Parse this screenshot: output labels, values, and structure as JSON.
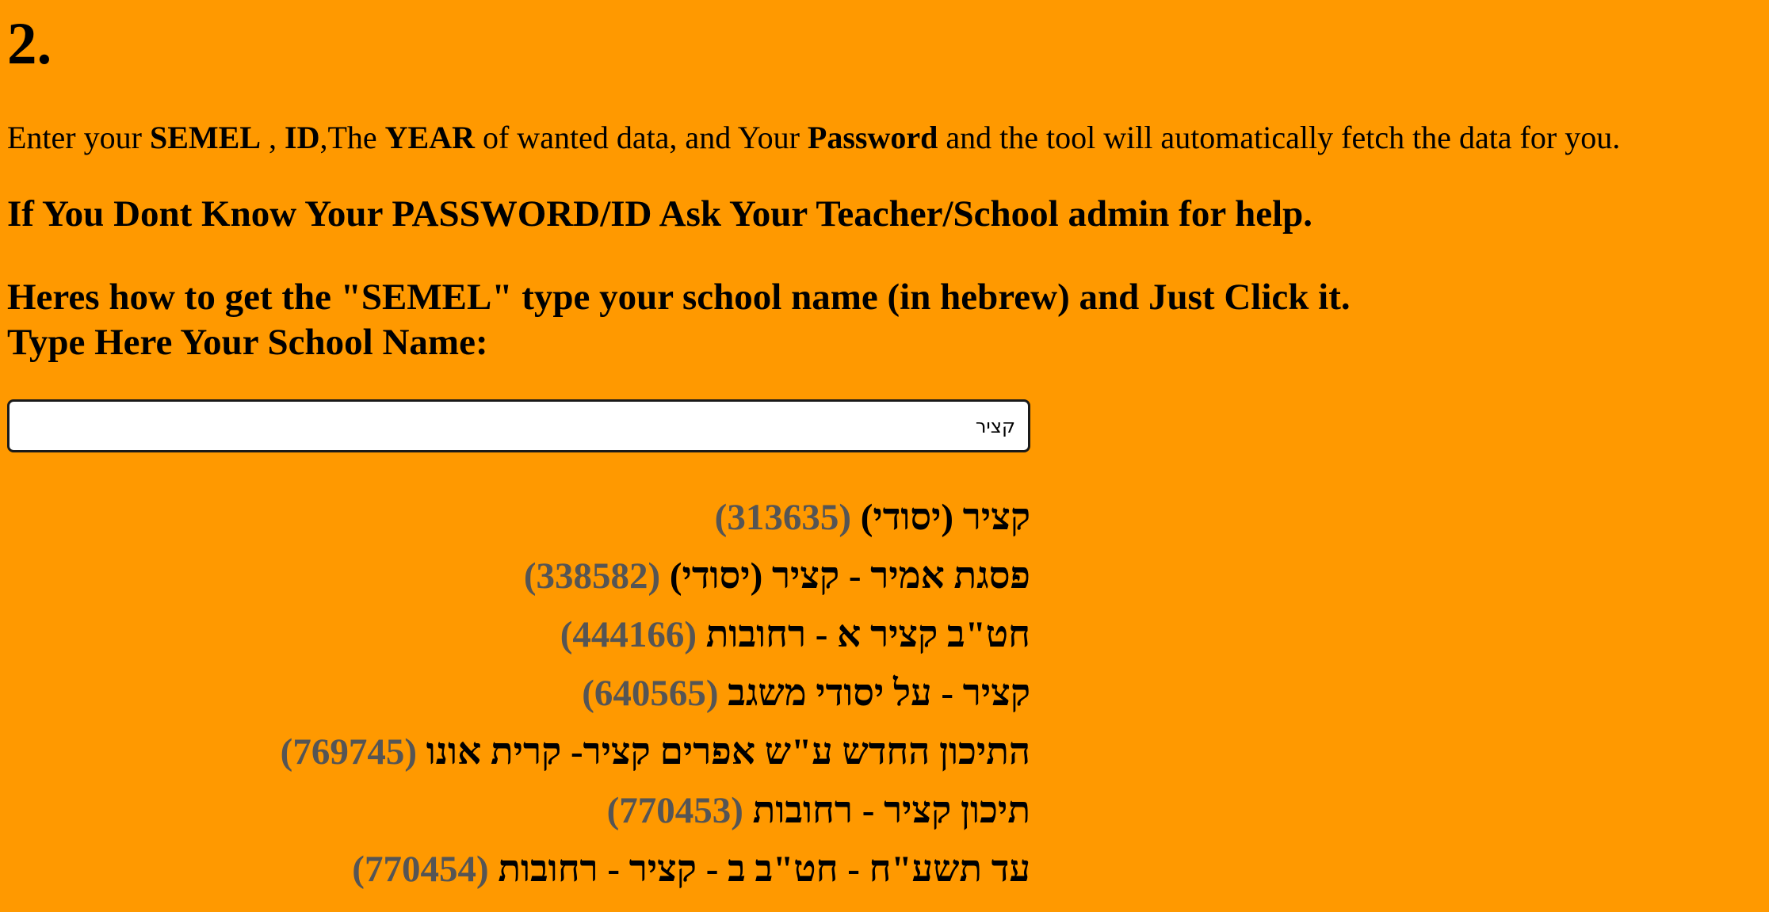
{
  "step": {
    "number": "2."
  },
  "instructions": {
    "part1": "Enter your ",
    "semel": "SEMEL",
    "part2": " , ",
    "id": "ID",
    "part3": ",The ",
    "year": "YEAR",
    "part4": " of wanted data, and Your ",
    "password": "Password",
    "part5": " and the tool will automatically fetch the data for you."
  },
  "help": {
    "text": "If You Dont Know Your PASSWORD/ID Ask Your Teacher/School admin for help."
  },
  "semel_howto": {
    "text": "Heres how to get the \"SEMEL\" type your school name (in hebrew) and Just Click it.",
    "type_label": "Type Here Your School Name:"
  },
  "search": {
    "value": "קציר"
  },
  "results": [
    {
      "name": "קציר (יסודי)",
      "code": "(313635)"
    },
    {
      "name": "פסגת אמיר - קציר (יסודי)",
      "code": "(338582)"
    },
    {
      "name": "חט\"ב קציר א - רחובות",
      "code": "(444166)"
    },
    {
      "name": "קציר - על יסודי משגב",
      "code": "(640565)"
    },
    {
      "name": "התיכון החדש ע\"ש אפרים קציר- קרית אונו",
      "code": "(769745)"
    },
    {
      "name": "תיכון קציר - רחובות",
      "code": "(770453)"
    },
    {
      "name": "עד תשע\"ח - חט\"ב ב - קציר - רחובות",
      "code": "(770454)"
    }
  ],
  "colors": {
    "background": "#ff9900",
    "code_text": "#555555"
  }
}
